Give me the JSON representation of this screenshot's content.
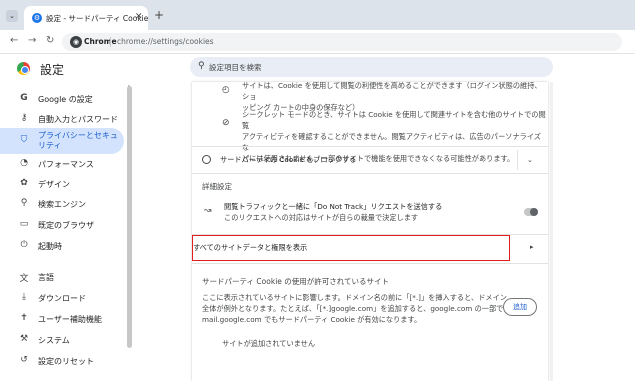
{
  "browser": {
    "tab_title": "設定 - サードパーティ Cookie",
    "tab_close": "✕",
    "new_tab": "+",
    "chrome_label": "Chrome",
    "url": "chrome://settings/cookies"
  },
  "header": {
    "title": "設定",
    "search_placeholder": "設定項目を検索"
  },
  "sidebar": {
    "items": [
      {
        "label": "Google の設定",
        "icon": "G"
      },
      {
        "label": "自動入力とパスワード",
        "icon": "🔑"
      },
      {
        "label": "プライバシーとセキュリティ",
        "icon": "🛡"
      },
      {
        "label": "パフォーマンス",
        "icon": "◔"
      },
      {
        "label": "デザイン",
        "icon": "🎨"
      },
      {
        "label": "検索エンジン",
        "icon": "🔍"
      },
      {
        "label": "既定のブラウザ",
        "icon": "▭"
      },
      {
        "label": "起動時",
        "icon": "⏻"
      },
      {
        "label": "言語",
        "icon": "文"
      },
      {
        "label": "ダウンロード",
        "icon": "⤓"
      },
      {
        "label": "ユーザー補助機能",
        "icon": "🚹"
      },
      {
        "label": "システム",
        "icon": "🔧"
      },
      {
        "label": "設定のリセット",
        "icon": "↺"
      }
    ]
  },
  "main": {
    "row1": {
      "line1": "サイトは、Cookie を使用して閲覧の利便性を高めることができます（ログイン状態の維持、ショ",
      "line2": "ッピング カートの中身の保存など）"
    },
    "row2": {
      "line1": "シークレット モードのとき、サイトは Cookie を使用して関連サイトを含む他のサイトでの閲覧",
      "line2": "アクティビティを確認することができません。閲覧アクティビティは、広告のパーソナライズな",
      "line3": "どには使用されません。一部のサイトで機能を使用できなくなる可能性があります。"
    },
    "block_option": "サードパーティの Cookie をブロックする",
    "advanced_title": "詳細設定",
    "dnt": {
      "line1": "閲覧トラフィックと一緒に「Do Not Track」リクエストを送信する",
      "line2": "このリクエストへの対応はサイトが自らの裁量で決定します"
    },
    "all_site_data": "すべてのサイトデータと権限を表示",
    "allowed_title": "サードパーティ Cookie の使用が許可されているサイト",
    "allowed_desc": {
      "line1": "ここに表示されているサイトに影響します。ドメイン名の前に「[*.]」を挿入すると、ドメイン",
      "line2": "全体が例外となります。たとえば、「[*.]google.com」を追加すると、google.com の一部である",
      "line3": "mail.google.com でもサードパーティ Cookie が有効になります。"
    },
    "add_button": "追加",
    "empty_text": "サイトが追加されていません"
  }
}
